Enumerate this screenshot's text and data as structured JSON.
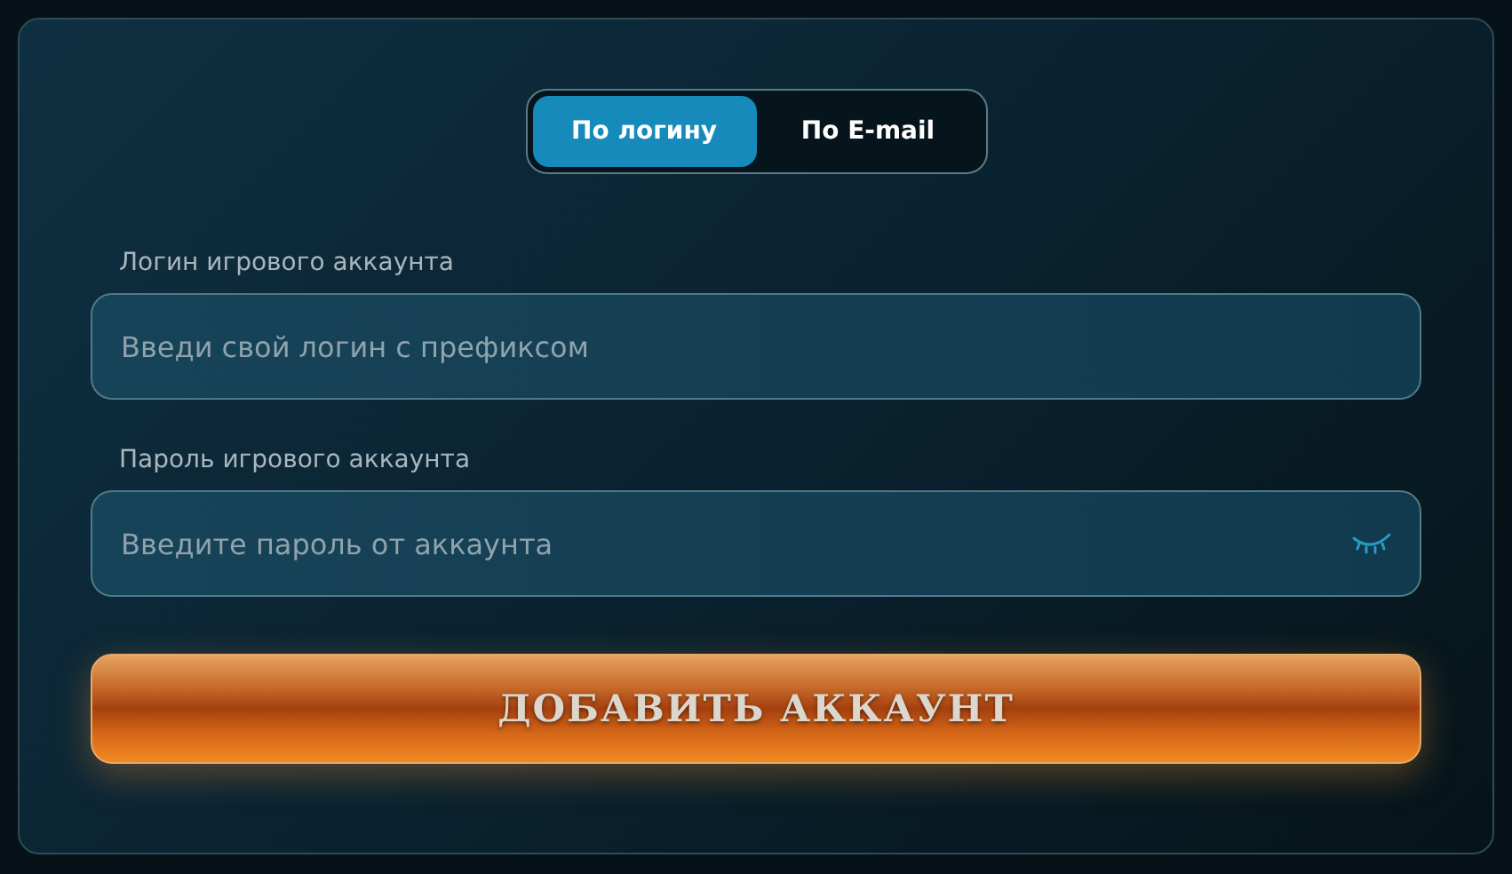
{
  "tabs": [
    {
      "label": "По логину",
      "selected": true
    },
    {
      "label": "По E-mail",
      "selected": false
    }
  ],
  "fields": [
    {
      "kind": "text",
      "label": "Логин игрового аккаунта",
      "placeholder": "Введи свой логин с префиксом"
    },
    {
      "kind": "password",
      "label": "Пароль игрового аккаунта",
      "placeholder": "Введите пароль от аккаунта"
    }
  ],
  "submit": {
    "label": "ДОБАВИТЬ АККАУНТ"
  }
}
